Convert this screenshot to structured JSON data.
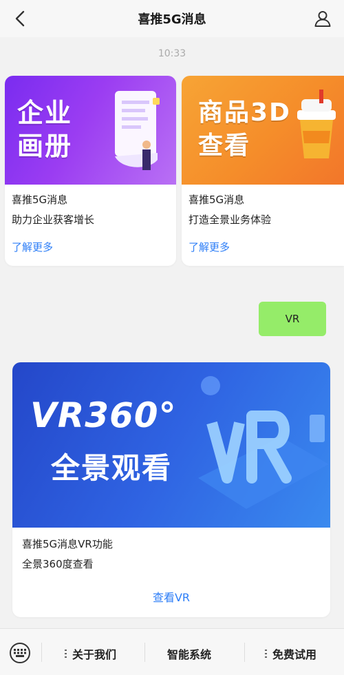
{
  "header": {
    "title": "喜推5G消息",
    "back_icon": "back-chevron-icon",
    "user_icon": "user-profile-icon"
  },
  "timestamp": "10:33",
  "cards": [
    {
      "banner_text": "企业画册",
      "line1": "喜推5G消息",
      "line2": "助力企业获客增长",
      "link": "了解更多",
      "banner_color": "#8a35f1"
    },
    {
      "banner_text": "商品3D查看",
      "line1": "喜推5G消息",
      "line2": "打造全景业务体验",
      "link": "了解更多",
      "banner_color": "#f5922d"
    },
    {
      "banner_line1": "VR360°",
      "banner_line2": "全景观看",
      "line1": "喜推5G消息VR功能",
      "line2": "全景360度查看",
      "link": "查看VR",
      "banner_color": "#2f63e2"
    }
  ],
  "reply_bubble": {
    "text": "VR",
    "color": "#95ec69"
  },
  "bottom_menu": {
    "keyboard_icon": "keyboard-icon",
    "items": [
      "关于我们",
      "智能系统",
      "免费试用"
    ]
  },
  "colors": {
    "link": "#2d7ef7",
    "background": "#f2f2f2"
  }
}
